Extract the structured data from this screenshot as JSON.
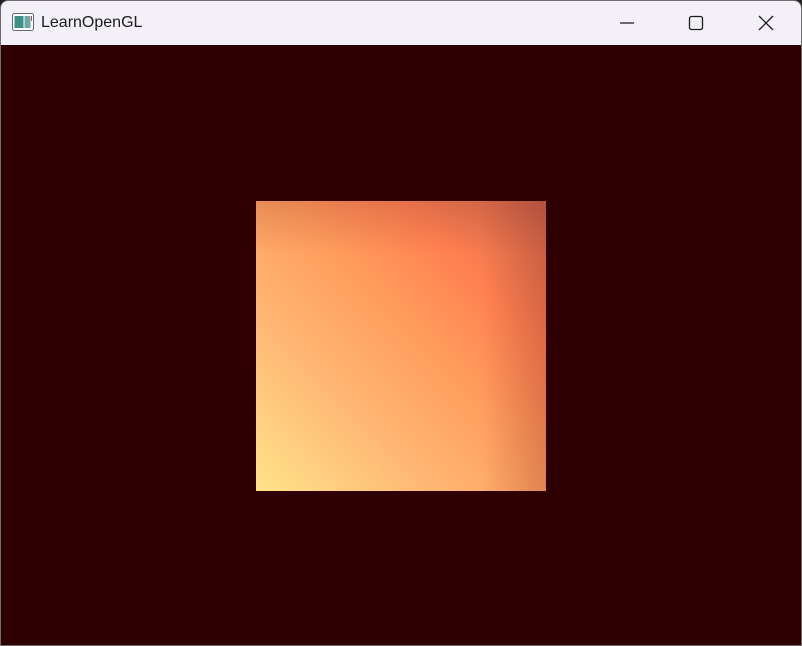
{
  "window": {
    "title": "LearnOpenGL",
    "icon": "app-window-icon",
    "controls": {
      "minimize_icon": "minimize-icon",
      "maximize_icon": "maximize-icon",
      "close_icon": "close-icon"
    }
  },
  "viewport": {
    "clear_color": "#2e0002",
    "quad_colors": [
      "#ffe38a",
      "#ffb874",
      "#ff9c5c",
      "#ff8050",
      "#d2694b"
    ]
  }
}
